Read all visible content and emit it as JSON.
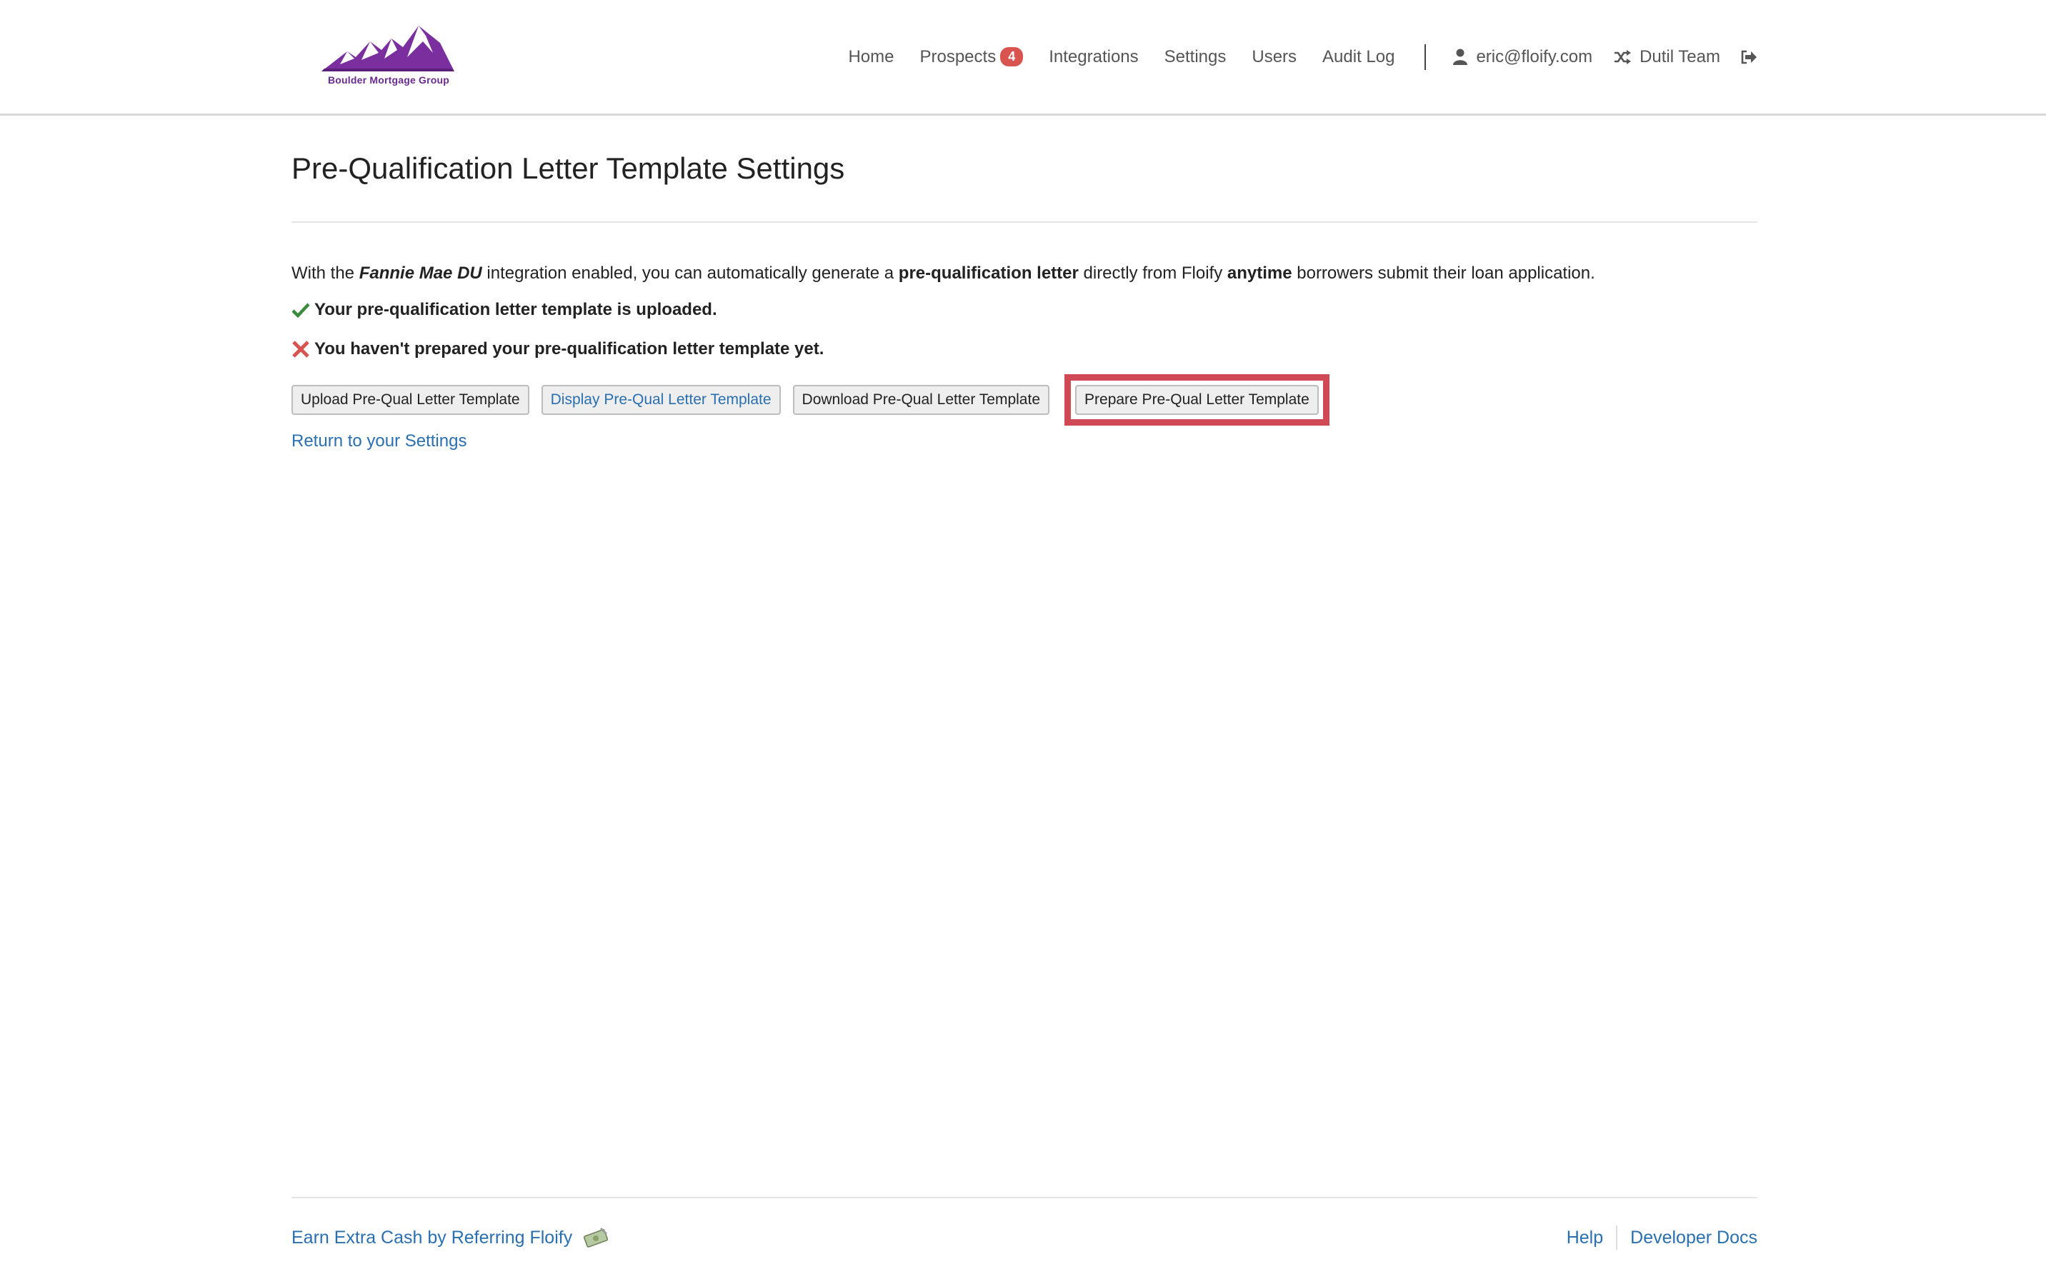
{
  "brand": {
    "logo_text": "Boulder Mortgage Group",
    "color": "#7b2f9e"
  },
  "nav": {
    "items": [
      {
        "label": "Home"
      },
      {
        "label": "Prospects",
        "badge": "4"
      },
      {
        "label": "Integrations"
      },
      {
        "label": "Settings"
      },
      {
        "label": "Users"
      },
      {
        "label": "Audit Log"
      }
    ],
    "user_email": "eric@floify.com",
    "team": "Dutil Team",
    "icons": {
      "user": "user-icon",
      "team": "shuffle-icon",
      "logout": "sign-out-icon"
    }
  },
  "page": {
    "title": "Pre-Qualification Letter Template Settings",
    "intro": {
      "p1": "With the ",
      "b1": "Fannie Mae DU",
      "p2": " integration enabled, you can automatically generate a ",
      "b2": "pre-qualification letter",
      "p3": " directly from Floify ",
      "b3": "anytime",
      "p4": " borrowers submit their loan application."
    },
    "status_uploaded": "Your pre-qualification letter template is uploaded.",
    "status_not_prepared": "You haven't prepared your pre-qualification letter template yet.",
    "buttons": {
      "upload": "Upload Pre-Qual Letter Template",
      "display": "Display Pre-Qual Letter Template",
      "download": "Download Pre-Qual Letter Template",
      "prepare": "Prepare Pre-Qual Letter Template"
    },
    "return_link": "Return to your Settings"
  },
  "footer": {
    "referral": "Earn Extra Cash by Referring Floify",
    "help": "Help",
    "developer_docs": "Developer Docs"
  },
  "colors": {
    "link": "#2a6fb0",
    "badge": "#d9534f",
    "success": "#3c8a3c",
    "error": "#d9534f",
    "highlight": "#d04a55"
  }
}
